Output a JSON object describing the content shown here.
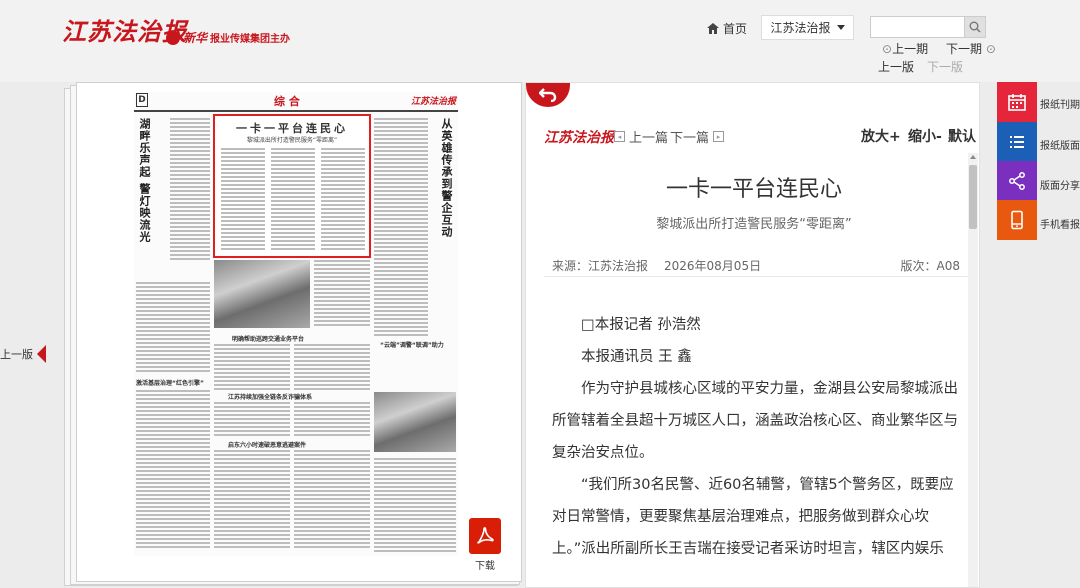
{
  "header": {
    "logo": "江苏法治报",
    "sublogo_mark": "新华",
    "sublogo_text": "报业传媒集团主办",
    "home": "首页",
    "paper_select": "江苏法治报",
    "search_placeholder": "",
    "prev_issue": "上一期",
    "next_issue": "下一期",
    "prev_edition": "上一版",
    "next_edition": "下一版"
  },
  "newspaper": {
    "edition_letter": "D",
    "section": "综 合",
    "brand": "江苏法治报",
    "headline": "一卡一平台连民心",
    "headline_sub": "黎城派出所打造警民服务“零距离”",
    "left_vertical_title": "湖畔乐声起 警灯映流光",
    "right_vertical_title": "从英雄传承到警企互动",
    "sub_heads": [
      "明确帮助巡跨交通业务平台",
      "“云端”调警“联调”助力",
      "激活基层治理“红色引擎”",
      "江苏持续加强全链条反诈骗体系",
      "启东六小时速破恶意逃避案件"
    ]
  },
  "prev_page": "上一版",
  "download": "下载",
  "article": {
    "brand": "江苏法治报",
    "prev_article": "上一篇",
    "next_article": "下一篇",
    "zoom_in": "放大+",
    "zoom_out": "缩小-",
    "zoom_reset": "默认",
    "title": "一卡一平台连民心",
    "subtitle": "黎城派出所打造警民服务“零距离”",
    "source": "来源：江苏法治报",
    "date": "2026年08月05日",
    "edition": "版次：A08",
    "byline1": "□本报记者 孙浩然",
    "byline2": "本报通讯员 王 鑫",
    "para1": "作为守护县城核心区域的平安力量，金湖县公安局黎城派出所管辖着全县超十万城区人口，涵盖政治核心区、商业繁华区与复杂治安点位。",
    "para2": "“我们所30名民警、近60名辅警，管辖5个警务区，既要应对日常警情，更要聚焦基层治理难点，把服务做到群众心坎上。”派出所副所长王吉瑞在接受记者采访时坦言，辖区内娱乐"
  },
  "tools": [
    {
      "label": "报纸刊期",
      "color": "#e5253a",
      "icon": "calendar-icon"
    },
    {
      "label": "报纸版面",
      "color": "#1c5fb6",
      "icon": "list-icon"
    },
    {
      "label": "版面分享",
      "color": "#7a2fbf",
      "icon": "share-icon"
    },
    {
      "label": "手机看报",
      "color": "#e8580e",
      "icon": "phone-icon"
    }
  ]
}
